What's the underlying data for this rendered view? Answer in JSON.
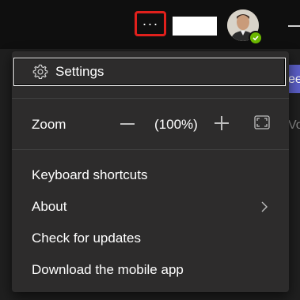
{
  "topbar": {
    "more_label": "···"
  },
  "menu": {
    "settings_label": "Settings",
    "zoom": {
      "label": "Zoom",
      "value": "(100%)"
    },
    "items": [
      {
        "label": "Keyboard shortcuts"
      },
      {
        "label": "About"
      },
      {
        "label": "Check for updates"
      },
      {
        "label": "Download the mobile app"
      }
    ]
  },
  "background": {
    "partial_text_1": "ee",
    "partial_text_2": "Vo"
  },
  "colors": {
    "highlight": "#e0201c",
    "menu_bg": "#2d2c2c",
    "presence": "#6bb700",
    "accent": "#5b5fc7"
  }
}
